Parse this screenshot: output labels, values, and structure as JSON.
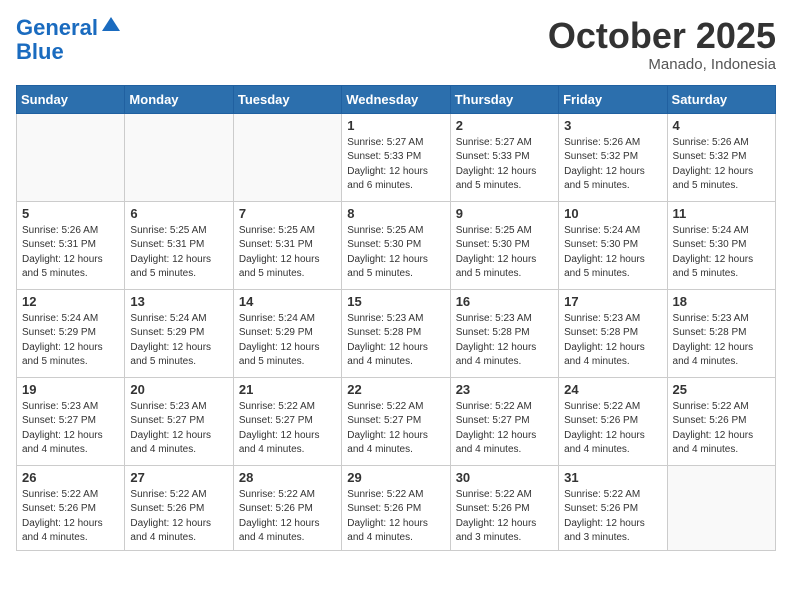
{
  "header": {
    "logo_line1": "General",
    "logo_line2": "Blue",
    "month": "October 2025",
    "location": "Manado, Indonesia"
  },
  "weekdays": [
    "Sunday",
    "Monday",
    "Tuesday",
    "Wednesday",
    "Thursday",
    "Friday",
    "Saturday"
  ],
  "weeks": [
    [
      {
        "day": "",
        "info": ""
      },
      {
        "day": "",
        "info": ""
      },
      {
        "day": "",
        "info": ""
      },
      {
        "day": "1",
        "info": "Sunrise: 5:27 AM\nSunset: 5:33 PM\nDaylight: 12 hours\nand 6 minutes."
      },
      {
        "day": "2",
        "info": "Sunrise: 5:27 AM\nSunset: 5:33 PM\nDaylight: 12 hours\nand 5 minutes."
      },
      {
        "day": "3",
        "info": "Sunrise: 5:26 AM\nSunset: 5:32 PM\nDaylight: 12 hours\nand 5 minutes."
      },
      {
        "day": "4",
        "info": "Sunrise: 5:26 AM\nSunset: 5:32 PM\nDaylight: 12 hours\nand 5 minutes."
      }
    ],
    [
      {
        "day": "5",
        "info": "Sunrise: 5:26 AM\nSunset: 5:31 PM\nDaylight: 12 hours\nand 5 minutes."
      },
      {
        "day": "6",
        "info": "Sunrise: 5:25 AM\nSunset: 5:31 PM\nDaylight: 12 hours\nand 5 minutes."
      },
      {
        "day": "7",
        "info": "Sunrise: 5:25 AM\nSunset: 5:31 PM\nDaylight: 12 hours\nand 5 minutes."
      },
      {
        "day": "8",
        "info": "Sunrise: 5:25 AM\nSunset: 5:30 PM\nDaylight: 12 hours\nand 5 minutes."
      },
      {
        "day": "9",
        "info": "Sunrise: 5:25 AM\nSunset: 5:30 PM\nDaylight: 12 hours\nand 5 minutes."
      },
      {
        "day": "10",
        "info": "Sunrise: 5:24 AM\nSunset: 5:30 PM\nDaylight: 12 hours\nand 5 minutes."
      },
      {
        "day": "11",
        "info": "Sunrise: 5:24 AM\nSunset: 5:30 PM\nDaylight: 12 hours\nand 5 minutes."
      }
    ],
    [
      {
        "day": "12",
        "info": "Sunrise: 5:24 AM\nSunset: 5:29 PM\nDaylight: 12 hours\nand 5 minutes."
      },
      {
        "day": "13",
        "info": "Sunrise: 5:24 AM\nSunset: 5:29 PM\nDaylight: 12 hours\nand 5 minutes."
      },
      {
        "day": "14",
        "info": "Sunrise: 5:24 AM\nSunset: 5:29 PM\nDaylight: 12 hours\nand 5 minutes."
      },
      {
        "day": "15",
        "info": "Sunrise: 5:23 AM\nSunset: 5:28 PM\nDaylight: 12 hours\nand 4 minutes."
      },
      {
        "day": "16",
        "info": "Sunrise: 5:23 AM\nSunset: 5:28 PM\nDaylight: 12 hours\nand 4 minutes."
      },
      {
        "day": "17",
        "info": "Sunrise: 5:23 AM\nSunset: 5:28 PM\nDaylight: 12 hours\nand 4 minutes."
      },
      {
        "day": "18",
        "info": "Sunrise: 5:23 AM\nSunset: 5:28 PM\nDaylight: 12 hours\nand 4 minutes."
      }
    ],
    [
      {
        "day": "19",
        "info": "Sunrise: 5:23 AM\nSunset: 5:27 PM\nDaylight: 12 hours\nand 4 minutes."
      },
      {
        "day": "20",
        "info": "Sunrise: 5:23 AM\nSunset: 5:27 PM\nDaylight: 12 hours\nand 4 minutes."
      },
      {
        "day": "21",
        "info": "Sunrise: 5:22 AM\nSunset: 5:27 PM\nDaylight: 12 hours\nand 4 minutes."
      },
      {
        "day": "22",
        "info": "Sunrise: 5:22 AM\nSunset: 5:27 PM\nDaylight: 12 hours\nand 4 minutes."
      },
      {
        "day": "23",
        "info": "Sunrise: 5:22 AM\nSunset: 5:27 PM\nDaylight: 12 hours\nand 4 minutes."
      },
      {
        "day": "24",
        "info": "Sunrise: 5:22 AM\nSunset: 5:26 PM\nDaylight: 12 hours\nand 4 minutes."
      },
      {
        "day": "25",
        "info": "Sunrise: 5:22 AM\nSunset: 5:26 PM\nDaylight: 12 hours\nand 4 minutes."
      }
    ],
    [
      {
        "day": "26",
        "info": "Sunrise: 5:22 AM\nSunset: 5:26 PM\nDaylight: 12 hours\nand 4 minutes."
      },
      {
        "day": "27",
        "info": "Sunrise: 5:22 AM\nSunset: 5:26 PM\nDaylight: 12 hours\nand 4 minutes."
      },
      {
        "day": "28",
        "info": "Sunrise: 5:22 AM\nSunset: 5:26 PM\nDaylight: 12 hours\nand 4 minutes."
      },
      {
        "day": "29",
        "info": "Sunrise: 5:22 AM\nSunset: 5:26 PM\nDaylight: 12 hours\nand 4 minutes."
      },
      {
        "day": "30",
        "info": "Sunrise: 5:22 AM\nSunset: 5:26 PM\nDaylight: 12 hours\nand 3 minutes."
      },
      {
        "day": "31",
        "info": "Sunrise: 5:22 AM\nSunset: 5:26 PM\nDaylight: 12 hours\nand 3 minutes."
      },
      {
        "day": "",
        "info": ""
      }
    ]
  ]
}
